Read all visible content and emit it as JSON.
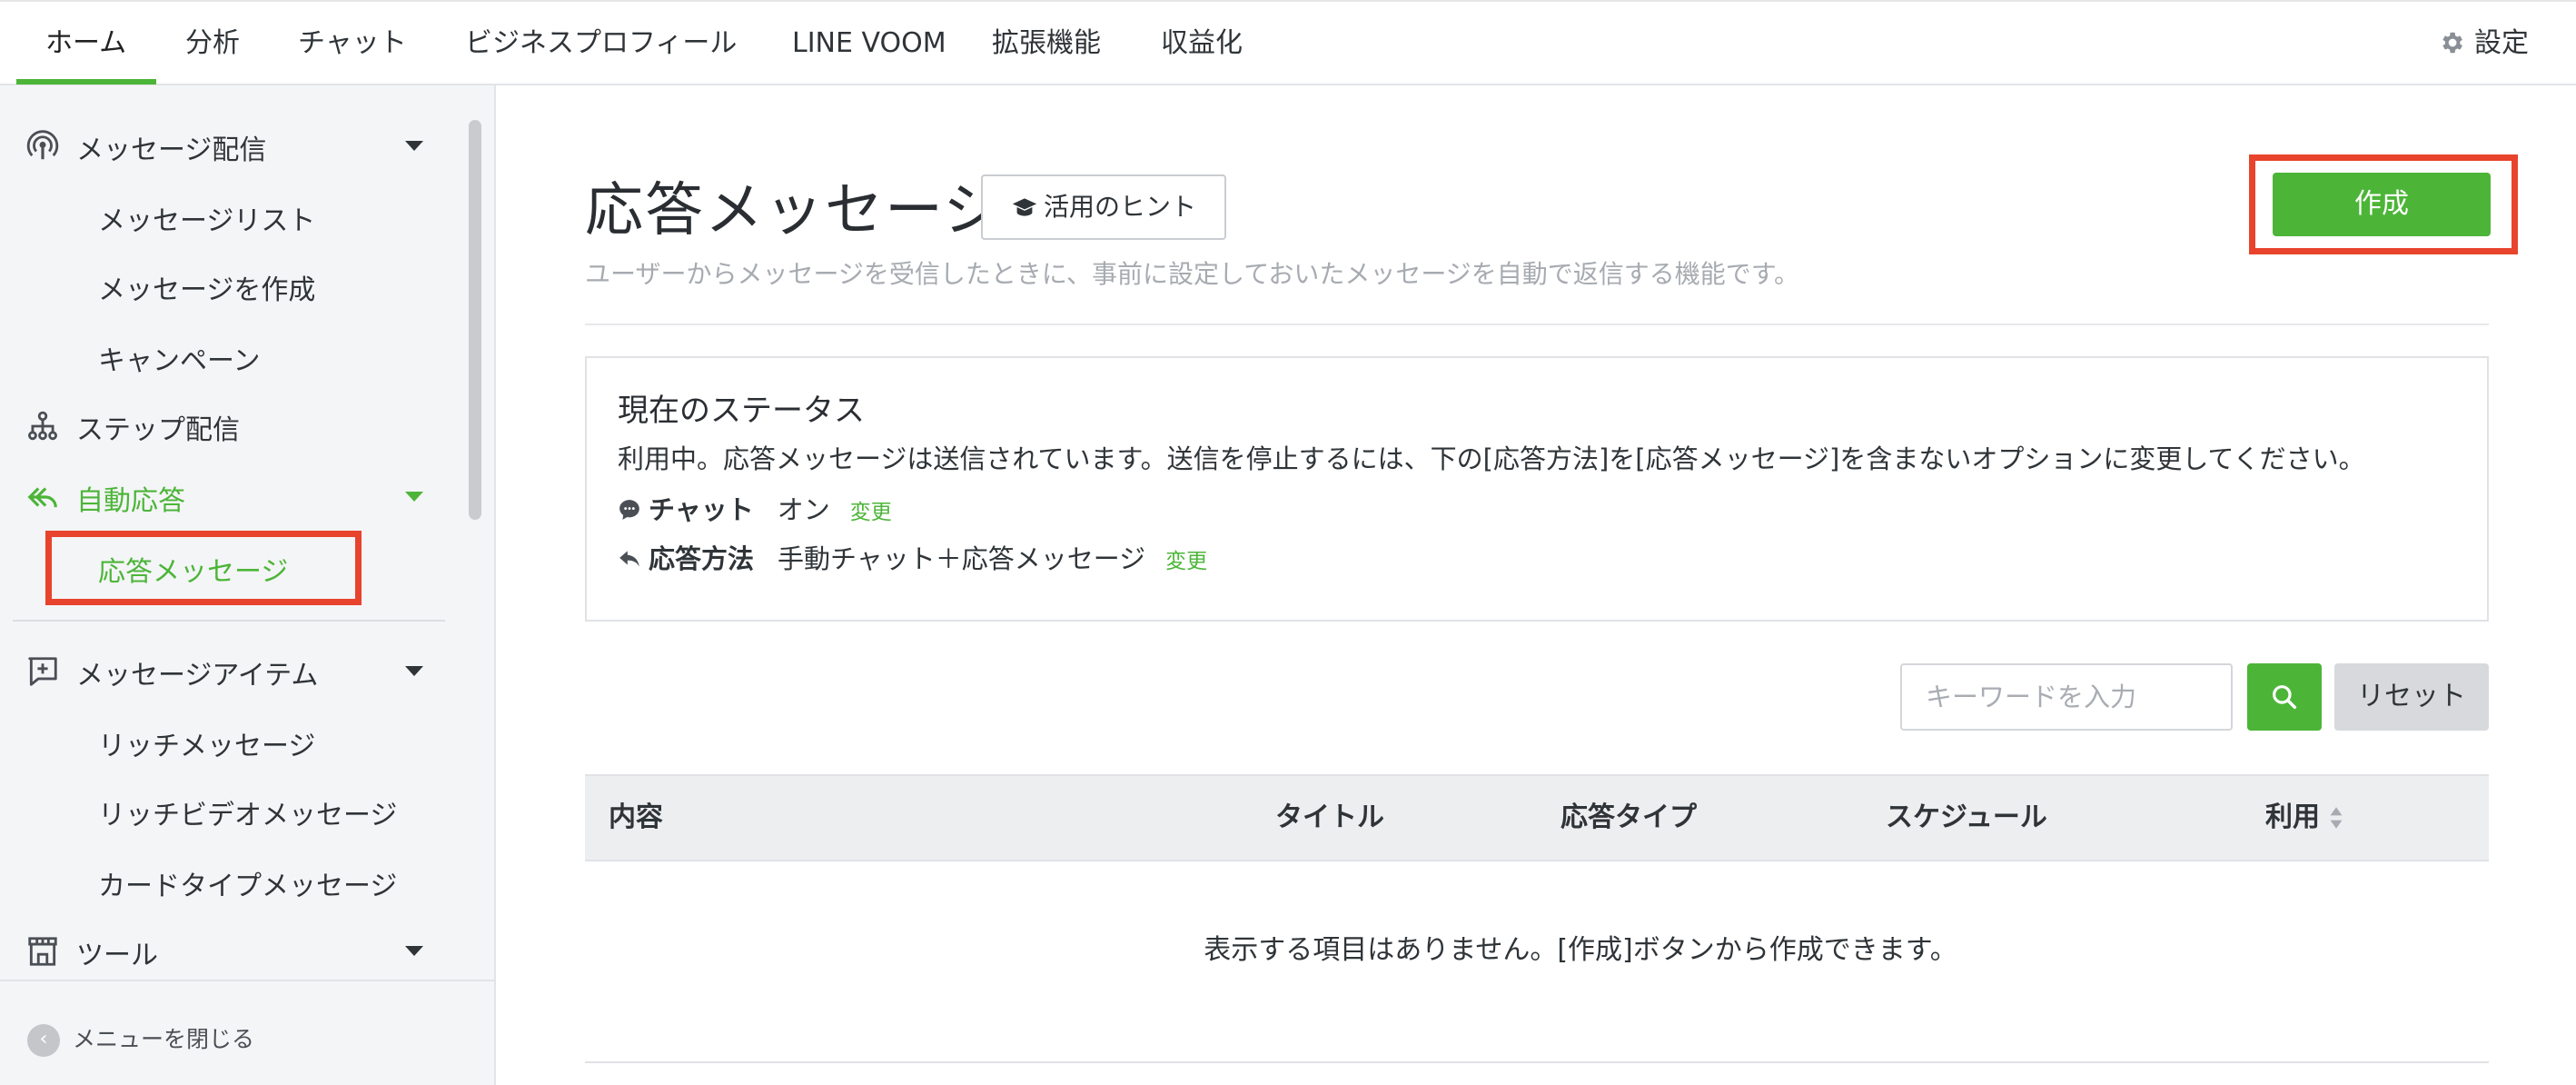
{
  "topnav": {
    "tabs": [
      "ホーム",
      "分析",
      "チャット",
      "ビジネスプロフィール",
      "LINE VOOM",
      "拡張機能",
      "収益化"
    ],
    "active_tab": "ホーム",
    "settings_label": "設定"
  },
  "sidebar": {
    "items": [
      {
        "label": "メッセージ配信",
        "icon": "broadcast-icon",
        "expandable": true
      },
      {
        "label": "メッセージリスト",
        "sub": true
      },
      {
        "label": "メッセージを作成",
        "sub": true
      },
      {
        "label": "キャンペーン",
        "sub": true
      },
      {
        "label": "ステップ配信",
        "icon": "step-flow-icon"
      },
      {
        "label": "自動応答",
        "icon": "reply-icon",
        "expandable": true,
        "active": true
      },
      {
        "label": "応答メッセージ",
        "sub": true,
        "active": true
      },
      {
        "label": "メッセージアイテム",
        "icon": "add-message-icon",
        "expandable": true
      },
      {
        "label": "リッチメッセージ",
        "sub": true
      },
      {
        "label": "リッチビデオメッセージ",
        "sub": true
      },
      {
        "label": "カードタイプメッセージ",
        "sub": true
      },
      {
        "label": "ツール",
        "icon": "store-icon",
        "expandable": true
      }
    ],
    "close_menu_label": "メニューを閉じる"
  },
  "main": {
    "title": "応答メッセージ",
    "hint_button": "活用のヒント",
    "description": "ユーザーからメッセージを受信したときに、事前に設定しておいたメッセージを自動で返信する機能です。",
    "create_button": "作成",
    "status": {
      "title": "現在のステータス",
      "text": "利用中。応答メッセージは送信されています。送信を停止するには、下の[応答方法]を[応答メッセージ]を含まないオプションに変更してください。",
      "chat_label": "チャット",
      "chat_value": "オン",
      "method_label": "応答方法",
      "method_value": "手動チャット＋応答メッセージ",
      "change_label": "変更"
    },
    "search": {
      "placeholder": "キーワードを入力",
      "reset_label": "リセット"
    },
    "table": {
      "columns": [
        "内容",
        "タイトル",
        "応答タイプ",
        "スケジュール",
        "利用"
      ],
      "empty_message": "表示する項目はありません。[作成]ボタンから作成できます。"
    }
  },
  "colors": {
    "accent_green": "#4cb538",
    "highlight_red": "#e8432d"
  }
}
